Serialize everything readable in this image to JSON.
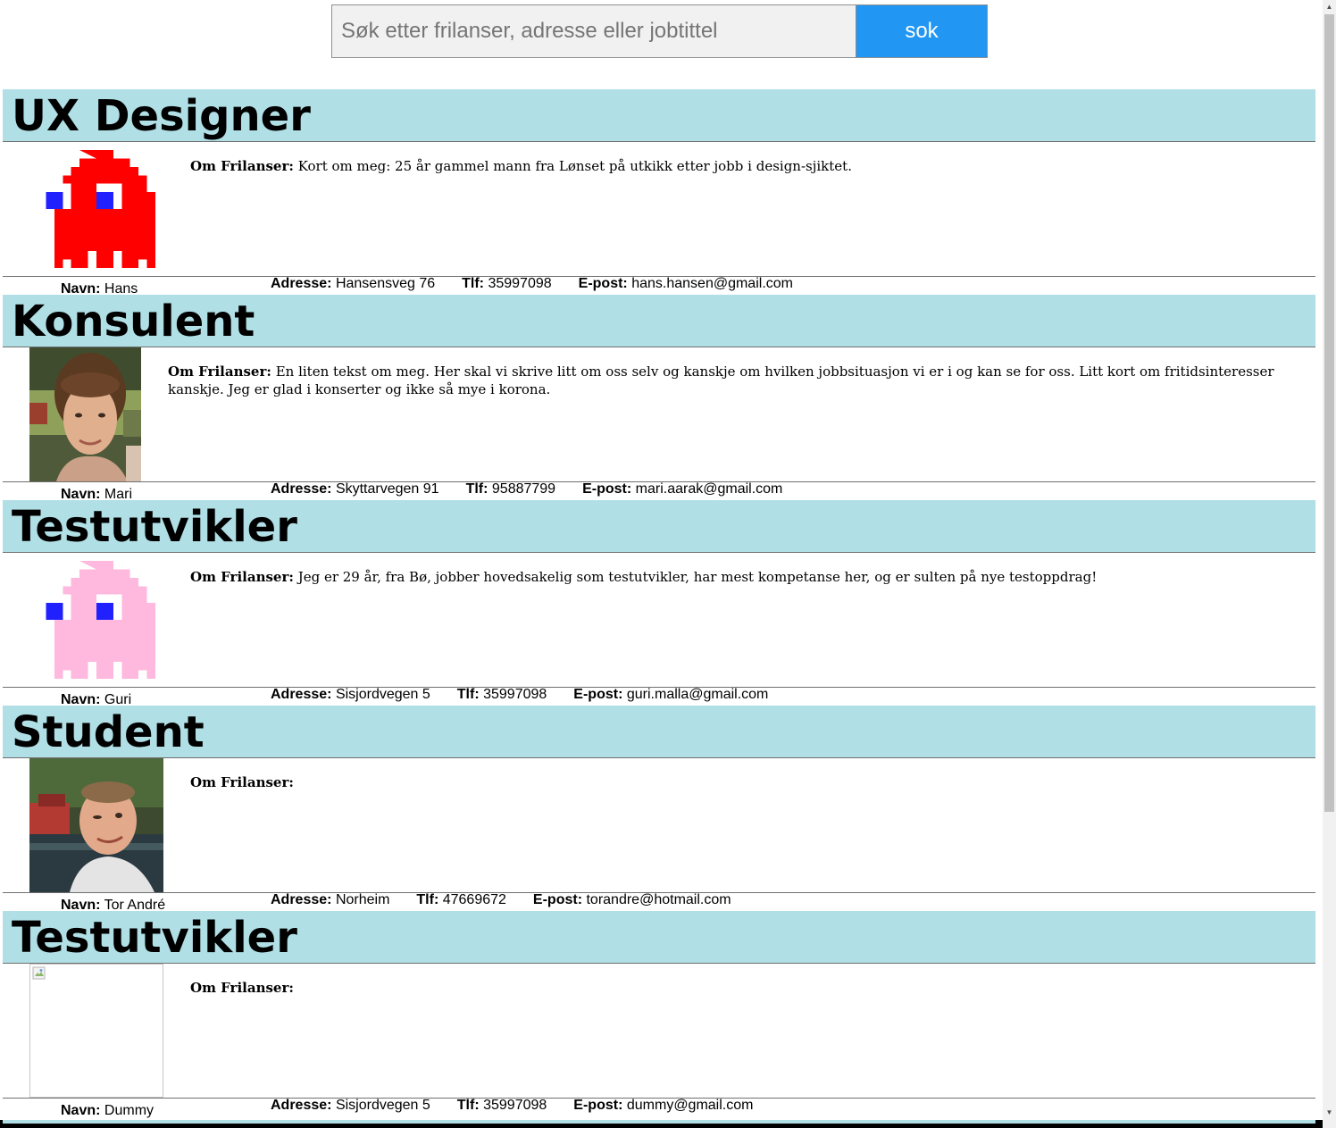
{
  "search": {
    "placeholder": "Søk etter frilanser, adresse eller jobtittel",
    "value": "",
    "button_label": "sok"
  },
  "labels": {
    "om": "Om Frilanser:",
    "navn": "Navn:",
    "adresse": "Adresse:",
    "tlf": "Tlf:",
    "epost": "E-post:"
  },
  "colors": {
    "title_bar": "#b0dfe5",
    "search_button": "#2196f3",
    "ghost_red": "#ff0000",
    "ghost_pink": "#ffb8de",
    "ghost_eye": "#2121ff"
  },
  "freelancers": [
    {
      "title": "UX Designer",
      "photo": "red-pixel-ghost",
      "about": "Kort om meg: 25 år gammel mann fra Lønset på utkikk etter jobb i design-sjiktet.",
      "name": "Hans",
      "address": "Hansensveg 76",
      "phone": "35997098",
      "email": "hans.hansen@gmail.com"
    },
    {
      "title": "Konsulent",
      "photo": "portrait-woman",
      "about": "En liten tekst om meg. Her skal vi skrive litt om oss selv og kanskje om hvilken jobbsituasjon vi er i og kan se for oss. Litt kort om fritidsinteresser kanskje. Jeg er glad i konserter og ikke så mye i korona.",
      "name": "Mari",
      "address": "Skyttarvegen 91",
      "phone": "95887799",
      "email": "mari.aarak@gmail.com"
    },
    {
      "title": "Testutvikler",
      "photo": "pink-pixel-ghost",
      "about": "Jeg er 29 år, fra Bø, jobber hovedsakelig som testutvikler, har mest kompetanse her, og er sulten på nye testoppdrag!",
      "name": "Guri",
      "address": "Sisjordvegen 5",
      "phone": "35997098",
      "email": "guri.malla@gmail.com"
    },
    {
      "title": "Student",
      "photo": "portrait-man",
      "about": "",
      "name": "Tor André",
      "address": "Norheim",
      "phone": "47669672",
      "email": "torandre@hotmail.com"
    },
    {
      "title": "Testutvikler",
      "photo": "broken-image",
      "about": "",
      "name": "Dummy",
      "address": "Sisjordvegen 5",
      "phone": "35997098",
      "email": "dummy@gmail.com"
    }
  ]
}
